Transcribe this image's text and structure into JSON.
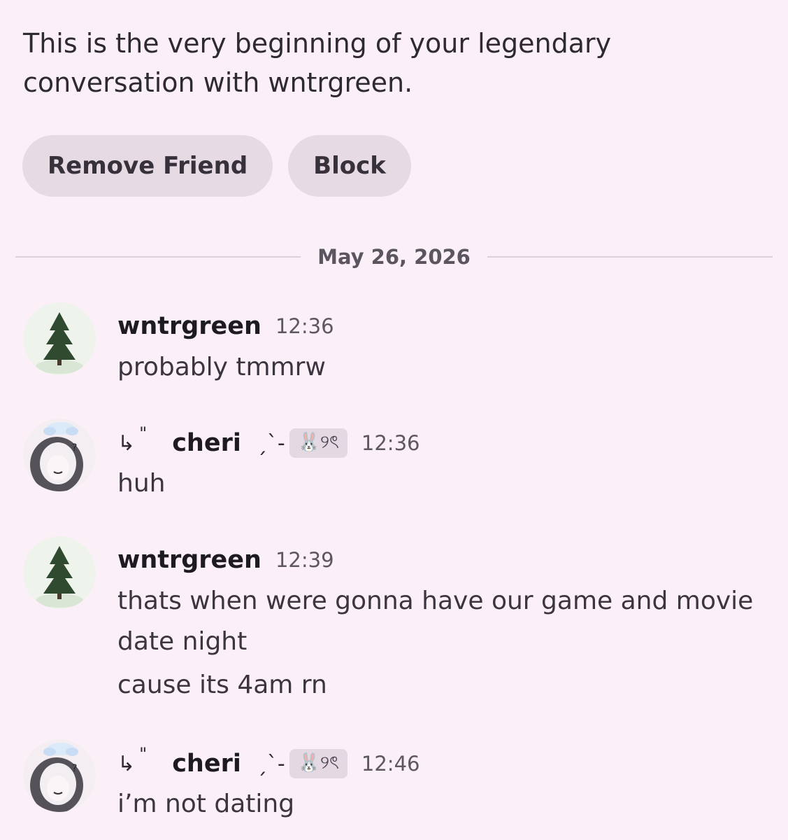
{
  "intro": {
    "text": "This is the very beginning of your legendary conversation with wntrgreen."
  },
  "actions": {
    "remove_friend": "Remove Friend",
    "block": "Block"
  },
  "divider": {
    "date": "May 26, 2026"
  },
  "messages": [
    {
      "author": "wntrgreen",
      "time": "12:36",
      "lines": [
        "probably tmmrw"
      ]
    },
    {
      "author_prefix_arrow": "↳",
      "author_prefix_quote": "\"",
      "author": "cheri",
      "author_suffix": "ˏˋ-",
      "tag": "🐰୨ৎ",
      "time": "12:36",
      "lines": [
        "huh"
      ]
    },
    {
      "author": "wntrgreen",
      "time": "12:39",
      "lines": [
        "thats when were gonna have our game and movie date night",
        "cause its 4am rn"
      ]
    },
    {
      "author_prefix_arrow": "↳",
      "author_prefix_quote": "\"",
      "author": "cheri",
      "author_suffix": "ˏˋ-",
      "tag": "🐰୨ৎ",
      "time": "12:46",
      "lines": [
        "i’m not dating"
      ]
    }
  ],
  "icons": {
    "tree_avatar": "pine-tree-avatar",
    "anime_avatar": "anime-girl-avatar"
  }
}
